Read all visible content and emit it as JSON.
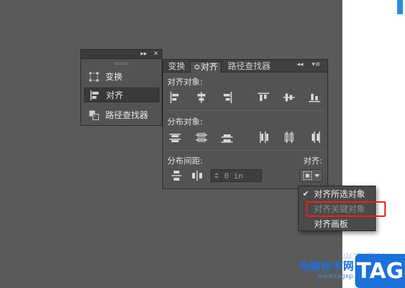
{
  "mini_panel": {
    "header_buttons": [
      "▸▸",
      "✕"
    ],
    "items": [
      {
        "label": "变换",
        "icon": "transform-icon",
        "active": false
      },
      {
        "label": "对齐",
        "icon": "align-icon",
        "active": true
      },
      {
        "label": "路径查找器",
        "icon": "pathfinder-icon",
        "active": false
      }
    ]
  },
  "align_panel": {
    "tabs": [
      {
        "label": "变换",
        "active": false
      },
      {
        "label": "≎对齐",
        "active": true
      },
      {
        "label": "路径查找器",
        "active": false
      }
    ],
    "tab_controls": [
      "◂◂",
      "▾≡"
    ],
    "sections": {
      "align_objects": {
        "label": "对齐对象:",
        "icons": [
          "align-left-edge-icon",
          "align-horizontal-center-icon",
          "align-right-edge-icon",
          "align-top-edge-icon",
          "align-vertical-center-icon",
          "align-bottom-edge-icon"
        ]
      },
      "distribute_objects": {
        "label": "分布对象:",
        "icons": [
          "distribute-top-icon",
          "distribute-vertical-center-icon",
          "distribute-bottom-icon",
          "distribute-left-icon",
          "distribute-horizontal-center-icon",
          "distribute-right-icon"
        ]
      },
      "distribute_spacing": {
        "label": "分布间距:",
        "icons": [
          "distribute-vertical-space-icon",
          "distribute-horizontal-space-icon"
        ],
        "value": "0 in"
      },
      "align_to": {
        "label": "对齐:",
        "icon": "align-to-selection-icon"
      }
    }
  },
  "dropdown": {
    "items": [
      {
        "label": "对齐所选对象",
        "checked": true,
        "enabled": true
      },
      {
        "label": "对齐关键对象",
        "checked": false,
        "enabled": false
      },
      {
        "label": "对齐画板",
        "checked": false,
        "enabled": true
      }
    ],
    "check_glyph": "✔"
  },
  "watermark": {
    "site_name": "电脑技术网",
    "url": "www.tagxp.com",
    "badge": "TAG",
    "faint_text": "光下载站"
  },
  "colors": {
    "workspace": "#5a5a5a",
    "panel": "#535353",
    "highlight_box": "#e8231c",
    "watermark_blue": "#1c72d8"
  }
}
